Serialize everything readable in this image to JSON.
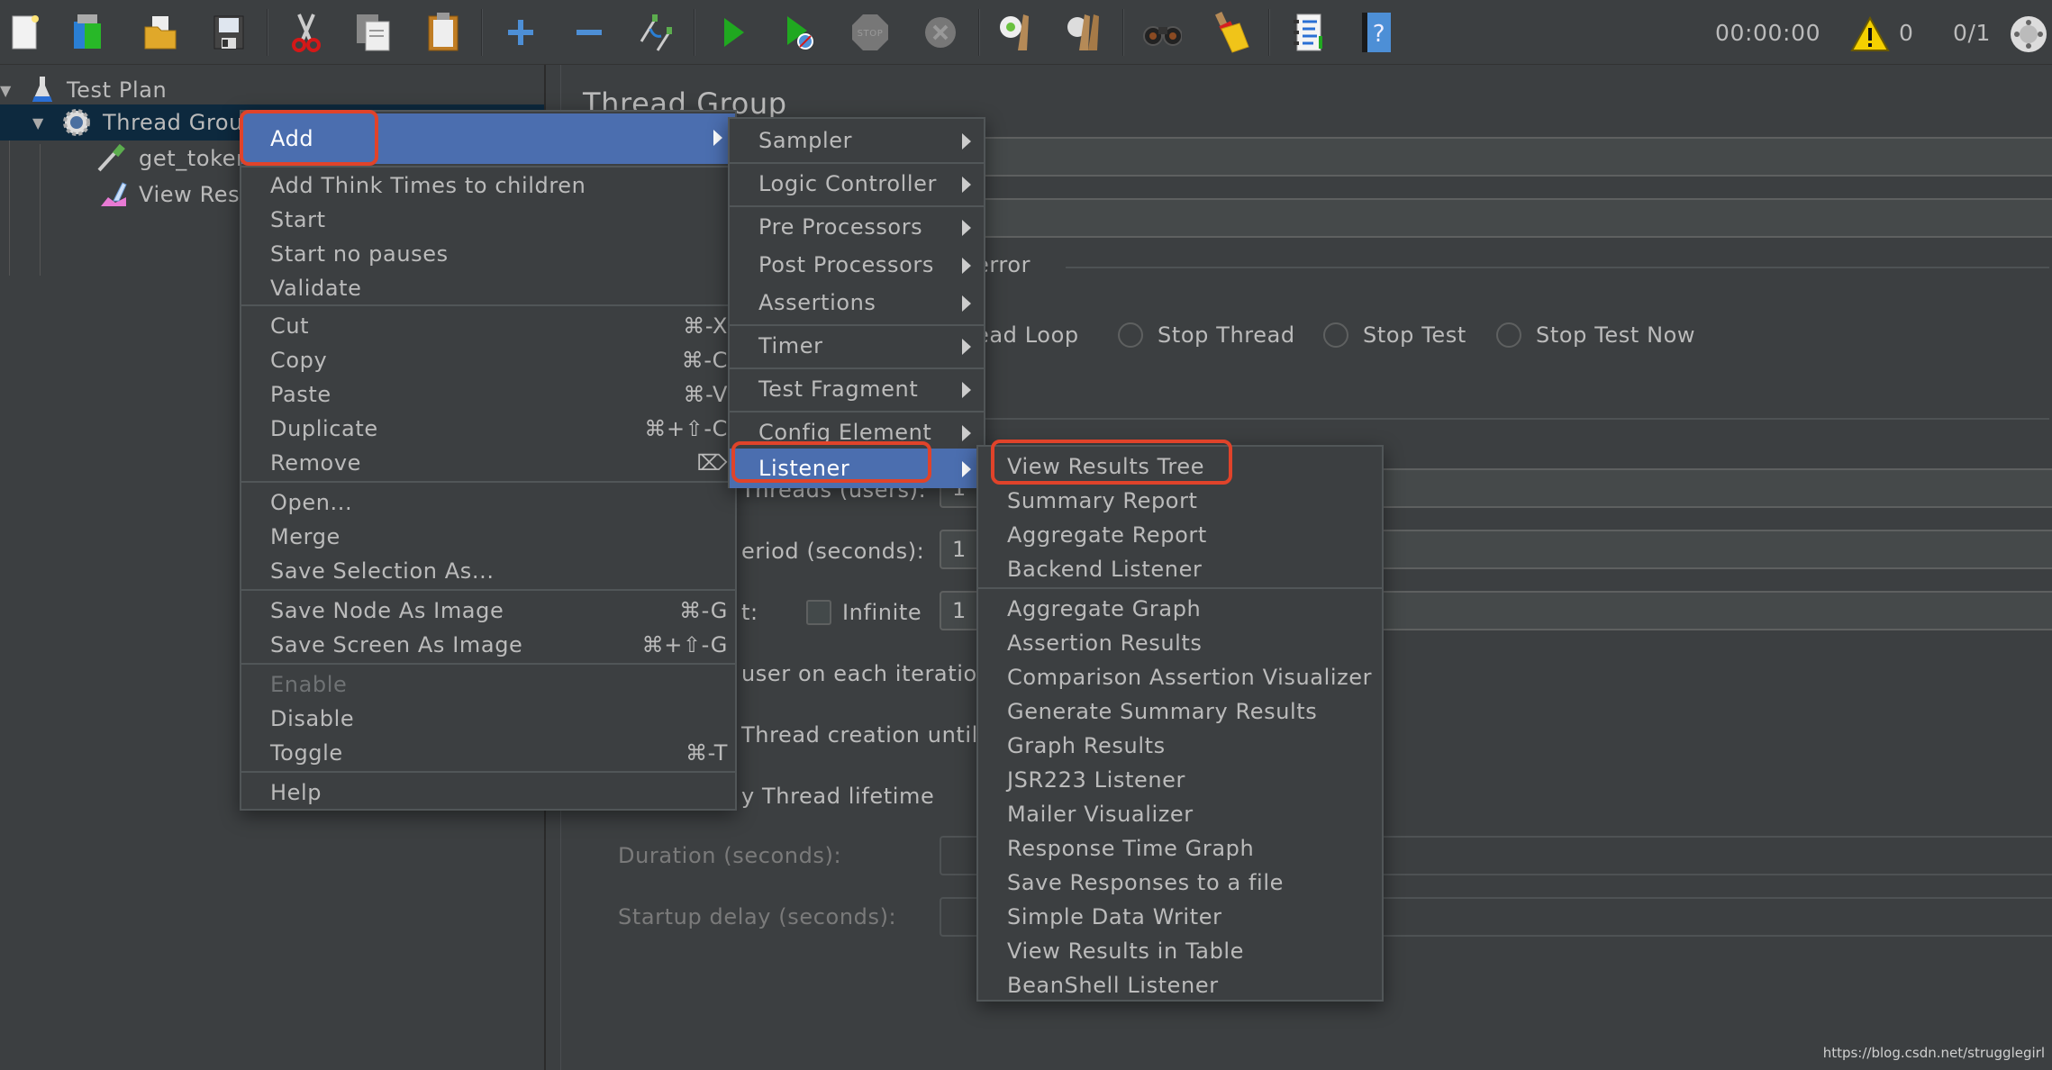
{
  "toolbar": {
    "buttons": [
      {
        "name": "new-icon",
        "label": "New"
      },
      {
        "name": "templates-icon",
        "label": "Templates"
      },
      {
        "name": "open-icon",
        "label": "Open"
      },
      {
        "name": "save-icon",
        "label": "Save"
      },
      {
        "name": "cut-icon",
        "label": "Cut"
      },
      {
        "name": "copy-icon",
        "label": "Copy"
      },
      {
        "name": "paste-icon",
        "label": "Paste"
      },
      {
        "name": "expand-icon",
        "label": "Expand"
      },
      {
        "name": "collapse-icon",
        "label": "Collapse"
      },
      {
        "name": "toggle-icon",
        "label": "Toggle"
      },
      {
        "name": "start-icon",
        "label": "Start"
      },
      {
        "name": "start-no-pauses-icon",
        "label": "Start no pauses"
      },
      {
        "name": "stop-icon",
        "label": "Stop"
      },
      {
        "name": "shutdown-icon",
        "label": "Shutdown"
      },
      {
        "name": "clear-icon",
        "label": "Clear"
      },
      {
        "name": "clear-all-icon",
        "label": "Clear All"
      },
      {
        "name": "search-icon",
        "label": "Search"
      },
      {
        "name": "reset-search-icon",
        "label": "Reset Search"
      },
      {
        "name": "function-helper-icon",
        "label": "Function Helper"
      },
      {
        "name": "help-icon",
        "label": "Help"
      }
    ],
    "elapsed_time": "00:00:00",
    "warning_count": "0",
    "threads_status": "0/1"
  },
  "tree": {
    "items": [
      {
        "label": "Test Plan",
        "level": 0,
        "expanded": true
      },
      {
        "label": "Thread Group",
        "level": 1,
        "expanded": true,
        "selected": true
      },
      {
        "label": "get_token",
        "level": 2
      },
      {
        "label": "View Results Tree",
        "level": 2
      }
    ]
  },
  "main": {
    "title": "Thread Group",
    "error_action_partial": "error",
    "radio_options": [
      "Start Next Thread Loop",
      "Stop Thread",
      "Stop Test",
      "Stop Test Now"
    ],
    "radio_visible_partial": "ead Loop",
    "threads_label_partial": "Threads (users):",
    "threads_value": "1",
    "rampup_label_partial": "eriod (seconds):",
    "rampup_value": "1",
    "loop_label_partial": "t:",
    "infinite_label": "Infinite",
    "infinite_checked": false,
    "loop_value": "1",
    "same_user_label_partial": "user on each iteration",
    "delay_thread_label_partial": "Thread creation until r",
    "specify_lifetime_label_partial": "y Thread lifetime",
    "duration_label": "Duration (seconds):",
    "startup_delay_label": "Startup delay (seconds):"
  },
  "context_menu": {
    "groups": [
      [
        {
          "label": "Add",
          "submenu": true,
          "active": true
        }
      ],
      [
        {
          "label": "Add Think Times to children"
        },
        {
          "label": "Start"
        },
        {
          "label": "Start no pauses"
        },
        {
          "label": "Validate"
        }
      ],
      [
        {
          "label": "Cut",
          "shortcut": "⌘-X"
        },
        {
          "label": "Copy",
          "shortcut": "⌘-C"
        },
        {
          "label": "Paste",
          "shortcut": "⌘-V"
        },
        {
          "label": "Duplicate",
          "shortcut": "⌘+⇧-C"
        },
        {
          "label": "Remove",
          "shortcut": "⌦"
        }
      ],
      [
        {
          "label": "Open..."
        },
        {
          "label": "Merge"
        },
        {
          "label": "Save Selection As..."
        }
      ],
      [
        {
          "label": "Save Node As Image",
          "shortcut": "⌘-G"
        },
        {
          "label": "Save Screen As Image",
          "shortcut": "⌘+⇧-G"
        }
      ],
      [
        {
          "label": "Enable",
          "disabled": true
        },
        {
          "label": "Disable"
        },
        {
          "label": "Toggle",
          "shortcut": "⌘-T"
        }
      ],
      [
        {
          "label": "Help"
        }
      ]
    ]
  },
  "add_submenu": {
    "items": [
      {
        "label": "Sampler"
      },
      {
        "label": "Logic Controller"
      },
      {
        "label": "Pre Processors"
      },
      {
        "label": "Post Processors"
      },
      {
        "label": "Assertions"
      },
      {
        "label": "Timer"
      },
      {
        "label": "Test Fragment"
      },
      {
        "label": "Config Element"
      },
      {
        "label": "Listener",
        "active": true
      }
    ]
  },
  "listener_submenu": {
    "groups": [
      [
        "View Results Tree",
        "Summary Report",
        "Aggregate Report",
        "Backend Listener"
      ],
      [
        "Aggregate Graph",
        "Assertion Results",
        "Comparison Assertion Visualizer",
        "Generate Summary Results",
        "Graph Results",
        "JSR223 Listener",
        "Mailer Visualizer",
        "Response Time Graph",
        "Save Responses to a file",
        "Simple Data Writer",
        "View Results in Table",
        "BeanShell Listener"
      ]
    ]
  },
  "annotations": {
    "highlight_color": "#e0432a",
    "highlighted": [
      "Add",
      "Listener",
      "View Results Tree"
    ]
  },
  "watermark": "https://blog.csdn.net/strugglegirl",
  "colors": {
    "background": "#3c3f41",
    "menu_active": "#4b6eaf",
    "tree_selected": "#0d293e",
    "text": "#bbbbbb"
  }
}
